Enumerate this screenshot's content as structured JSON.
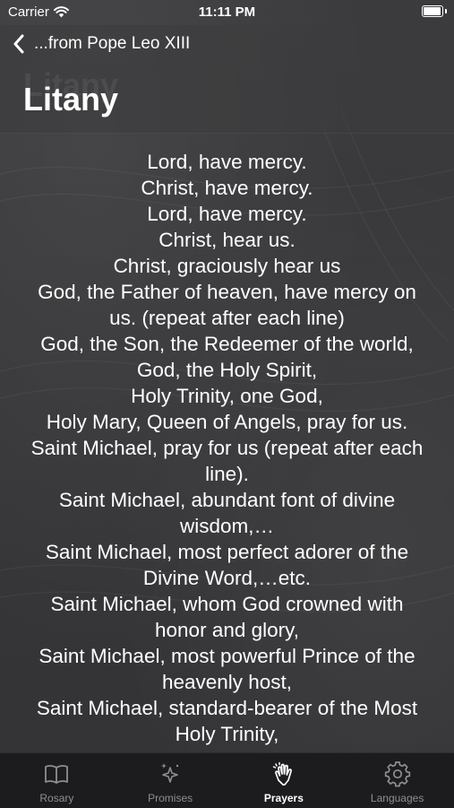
{
  "status_bar": {
    "carrier": "Carrier",
    "time": "11:11 PM"
  },
  "header": {
    "back_label": "...from Pope Leo XIII",
    "title": "Litany",
    "ghost_title": "Litany"
  },
  "prayer": {
    "lines": [
      "Lord, have mercy.",
      "Christ, have mercy.",
      "Lord, have mercy.",
      "Christ, hear us.",
      "Christ, graciously hear us",
      "God, the Father of heaven, have mercy on",
      "us. (repeat after each line)",
      "God, the Son, the Redeemer of the world,",
      "God, the Holy Spirit,",
      "Holy Trinity, one God,",
      "Holy Mary, Queen of Angels, pray for us.",
      "Saint Michael, pray for us (repeat after each",
      "line).",
      "Saint Michael, abundant font of divine",
      "wisdom,…",
      "Saint Michael, most perfect adorer of the",
      "Divine Word,…etc.",
      "Saint Michael, whom God crowned with",
      "honor and glory,",
      "Saint Michael, most powerful Prince of the",
      "heavenly host,",
      "Saint Michael, standard-bearer of the Most",
      "Holy Trinity,"
    ]
  },
  "tab_bar": {
    "tabs": [
      {
        "label": "Rosary",
        "icon": "book-icon",
        "active": false
      },
      {
        "label": "Promises",
        "icon": "sparkles-icon",
        "active": false
      },
      {
        "label": "Prayers",
        "icon": "praying-hands-icon",
        "active": true
      },
      {
        "label": "Languages",
        "icon": "gear-icon",
        "active": false
      }
    ]
  },
  "colors": {
    "background": "#3a3a3c",
    "tab_bar": "#1c1c1e",
    "tab_active": "#ffffff",
    "tab_inactive": "#8e8e93"
  }
}
